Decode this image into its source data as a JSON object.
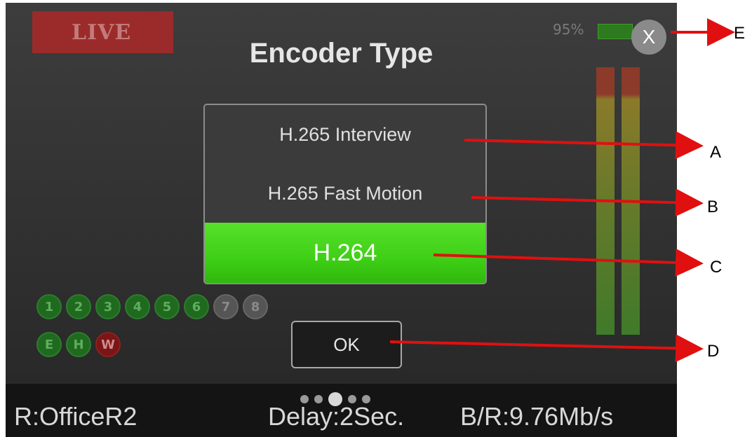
{
  "header": {
    "live_label": "LIVE",
    "battery_percent": "95%",
    "battery_level": 0.95,
    "title": "Encoder Type",
    "close_label": "X"
  },
  "encoder_options": [
    {
      "label": "H.265 Interview",
      "selected": false
    },
    {
      "label": "H.265 Fast Motion",
      "selected": false
    },
    {
      "label": "H.264",
      "selected": true
    }
  ],
  "channels": {
    "row1": [
      "1",
      "2",
      "3",
      "4",
      "5",
      "6",
      "7",
      "8"
    ],
    "row2": [
      "E",
      "H",
      "W"
    ]
  },
  "ok_label": "OK",
  "status_bar": {
    "receiver": "R:OfficeR2",
    "delay": "Delay:2Sec.",
    "bitrate": "B/R:9.76Mb/s"
  },
  "page_indicator": {
    "count": 5,
    "active_index": 2
  },
  "annotations": {
    "A": "A",
    "B": "B",
    "C": "C",
    "D": "D",
    "E": "E"
  },
  "colors": {
    "accent_green": "#3fcf16",
    "live_red": "#9b2b2b",
    "annotation_red": "#e01010"
  }
}
